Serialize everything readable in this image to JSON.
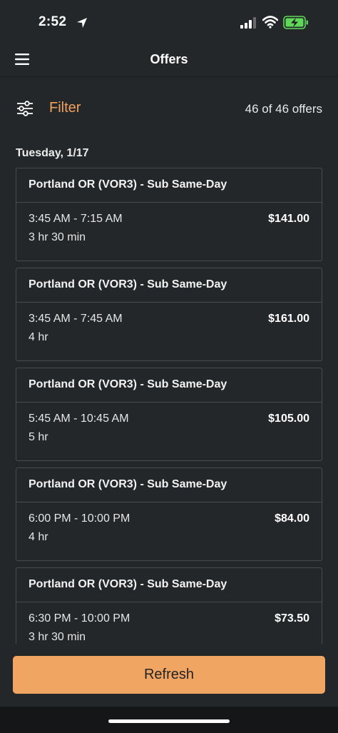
{
  "status_bar": {
    "time": "2:52"
  },
  "nav": {
    "title": "Offers"
  },
  "filter": {
    "label": "Filter",
    "count": "46 of 46 offers"
  },
  "day_heading": "Tuesday, 1/17",
  "offers": [
    {
      "location": "Portland OR (VOR3) - Sub Same-Day",
      "time": "3:45 AM - 7:15 AM",
      "duration": "3 hr 30 min",
      "price": "$141.00"
    },
    {
      "location": "Portland OR (VOR3) - Sub Same-Day",
      "time": "3:45 AM - 7:45 AM",
      "duration": "4 hr",
      "price": "$161.00"
    },
    {
      "location": "Portland OR (VOR3) - Sub Same-Day",
      "time": "5:45 AM - 10:45 AM",
      "duration": "5 hr",
      "price": "$105.00"
    },
    {
      "location": "Portland OR (VOR3) - Sub Same-Day",
      "time": "6:00 PM - 10:00 PM",
      "duration": "4 hr",
      "price": "$84.00"
    },
    {
      "location": "Portland OR (VOR3) - Sub Same-Day",
      "time": "6:30 PM - 10:00 PM",
      "duration": "3 hr 30 min",
      "price": "$73.50"
    }
  ],
  "refresh": {
    "label": "Refresh"
  },
  "colors": {
    "background": "#242729",
    "accent": "#f0a563",
    "card_border": "#4a4d50",
    "battery_charging": "#5fd85a"
  },
  "icons": [
    "location-arrow-icon",
    "cellular-signal-icon",
    "wifi-icon",
    "battery-charging-icon",
    "hamburger-menu-icon",
    "filter-sliders-icon"
  ]
}
